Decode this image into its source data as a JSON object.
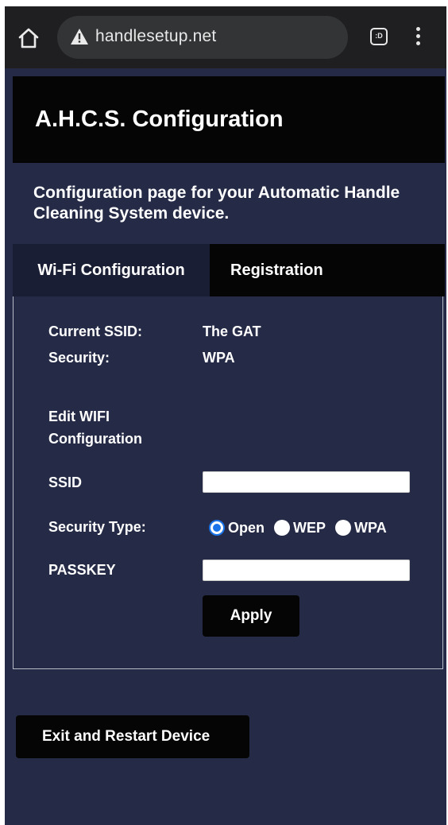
{
  "browser": {
    "url": "handlesetup.net",
    "tab_switcher_label": ":D",
    "home_icon": "home-icon",
    "warning_icon": "warning-triangle-icon",
    "menu_icon": "more-vert-icon"
  },
  "page": {
    "title": "A.H.C.S. Configuration",
    "subtitle": "Configuration page for your Automatic Handle Cleaning System device."
  },
  "tabs": [
    {
      "label": "Wi-Fi Configuration",
      "active": true
    },
    {
      "label": "Registration",
      "active": false
    }
  ],
  "wifi": {
    "current_ssid_label": "Current SSID:",
    "current_ssid_value": "The GAT",
    "security_label": "Security:",
    "security_value": "WPA",
    "edit_heading": "Edit WIFI Configuration",
    "ssid_label": "SSID",
    "ssid_value": "",
    "security_type_label": "Security Type:",
    "security_options": [
      {
        "label": "Open",
        "checked": true
      },
      {
        "label": "WEP",
        "checked": false
      },
      {
        "label": "WPA",
        "checked": false
      }
    ],
    "passkey_label": "PASSKEY",
    "passkey_value": "",
    "apply_label": "Apply"
  },
  "exit_label": "Exit and Restart Device",
  "colors": {
    "page_background": "#252a46",
    "header_background": "#050505",
    "active_tab_background": "#1a1e35",
    "radio_accent": "#1a73e8"
  }
}
